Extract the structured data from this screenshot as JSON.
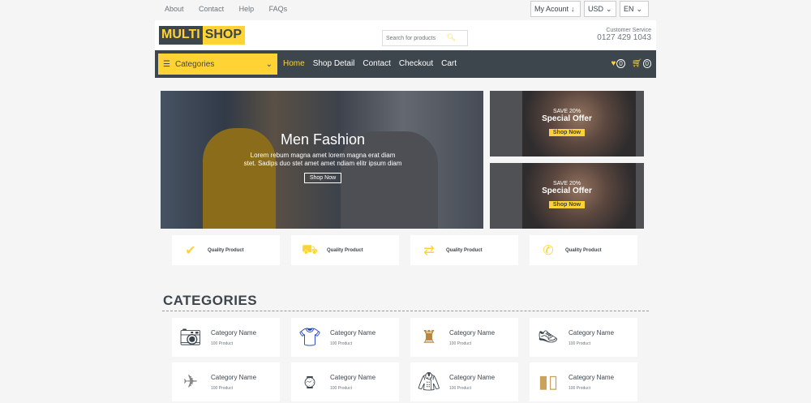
{
  "topbar": {
    "links": [
      "About",
      "Contact",
      "Help",
      "FAQs"
    ],
    "account": "My Acount",
    "currency": "USD",
    "language": "EN"
  },
  "header": {
    "logo_part1": "MULTI",
    "logo_part2": "SHOP",
    "search_placeholder": "Search for products",
    "cs_label": "Customer Service",
    "cs_phone": "0127 429 1043"
  },
  "nav": {
    "categories_label": "Categories",
    "menu": [
      "Home",
      "Shop Detail",
      "Contact",
      "Checkout",
      "Cart"
    ],
    "wishlist_count": "0",
    "cart_count": "0"
  },
  "hero": {
    "title": "Men Fashion",
    "description": "Lorem rebum magna amet lorem magna erat diam stet. Sadips duo stet amet amet ndiam elitr ipsum diam",
    "button": "Shop Now"
  },
  "offers": [
    {
      "label": "SAVE 20%",
      "title": "Special Offer",
      "button": "Shop Now"
    },
    {
      "label": "SAVE 20%",
      "title": "Special Offer",
      "button": "Shop Now"
    }
  ],
  "features": [
    {
      "icon": "check-icon",
      "text": "Quality Product"
    },
    {
      "icon": "shipping-icon",
      "text": "Quality Product"
    },
    {
      "icon": "exchange-icon",
      "text": "Quality Product"
    },
    {
      "icon": "phone-icon",
      "text": "Quality Product"
    }
  ],
  "categories": {
    "title": "CATEGORIES",
    "items": [
      {
        "name": "Category Name",
        "count": "100 Product",
        "icon": "camera-icon"
      },
      {
        "name": "Category Name",
        "count": "100 Product",
        "icon": "sweater-icon"
      },
      {
        "name": "Category Name",
        "count": "100 Product",
        "icon": "lamp-icon"
      },
      {
        "name": "Category Name",
        "count": "100 Product",
        "icon": "shoe-icon"
      },
      {
        "name": "Category Name",
        "count": "100 Product",
        "icon": "drone-icon"
      },
      {
        "name": "Category Name",
        "count": "100 Product",
        "icon": "watch-icon"
      },
      {
        "name": "Category Name",
        "count": "100 Product",
        "icon": "jacket-icon"
      },
      {
        "name": "Category Name",
        "count": "100 Product",
        "icon": "cosmetics-icon"
      }
    ]
  },
  "colors": {
    "accent": "#ffd333",
    "dark": "#3d464d"
  }
}
